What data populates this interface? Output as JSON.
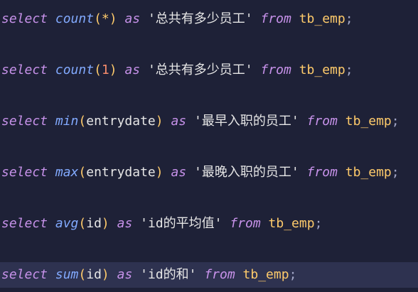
{
  "editor": {
    "lines": [
      {
        "kw_select": "select",
        "fn": "count",
        "lparen": "(",
        "arg": "*",
        "rparen": ")",
        "kw_as": "as",
        "alias": "'总共有多少员工'",
        "kw_from": "from",
        "table": "tb_emp",
        "semi": ";"
      },
      {
        "kw_select": "select",
        "fn": "count",
        "lparen": "(",
        "arg": "1",
        "rparen": ")",
        "kw_as": "as",
        "alias": "'总共有多少员工'",
        "kw_from": "from",
        "table": "tb_emp",
        "semi": ";"
      },
      {
        "kw_select": "select",
        "fn": "min",
        "lparen": "(",
        "arg": "entrydate",
        "rparen": ")",
        "kw_as": "as",
        "alias": "'最早入职的员工'",
        "kw_from": "from",
        "table": "tb_emp",
        "semi": ";"
      },
      {
        "kw_select": "select",
        "fn": "max",
        "lparen": "(",
        "arg": "entrydate",
        "rparen": ")",
        "kw_as": "as",
        "alias": "'最晚入职的员工'",
        "kw_from": "from",
        "table": "tb_emp",
        "semi": ";"
      },
      {
        "kw_select": "select",
        "fn": "avg",
        "lparen": "(",
        "arg": "id",
        "rparen": ")",
        "kw_as": "as",
        "alias": "'id的平均值'",
        "kw_from": "from",
        "table": "tb_emp",
        "semi": ";"
      },
      {
        "kw_select": "select",
        "fn": "sum",
        "lparen": "(",
        "arg": "id",
        "rparen": ")",
        "kw_as": "as",
        "alias": "'id的和'",
        "kw_from": "from",
        "table": "tb_emp",
        "semi": ";"
      }
    ],
    "colors": {
      "background": "#1e2137",
      "current_line": "#2e3250",
      "keyword": "#c792ea",
      "function": "#82aaff",
      "paren": "#ffcb6b",
      "number": "#f78c6c",
      "table": "#ffcb6b"
    }
  }
}
